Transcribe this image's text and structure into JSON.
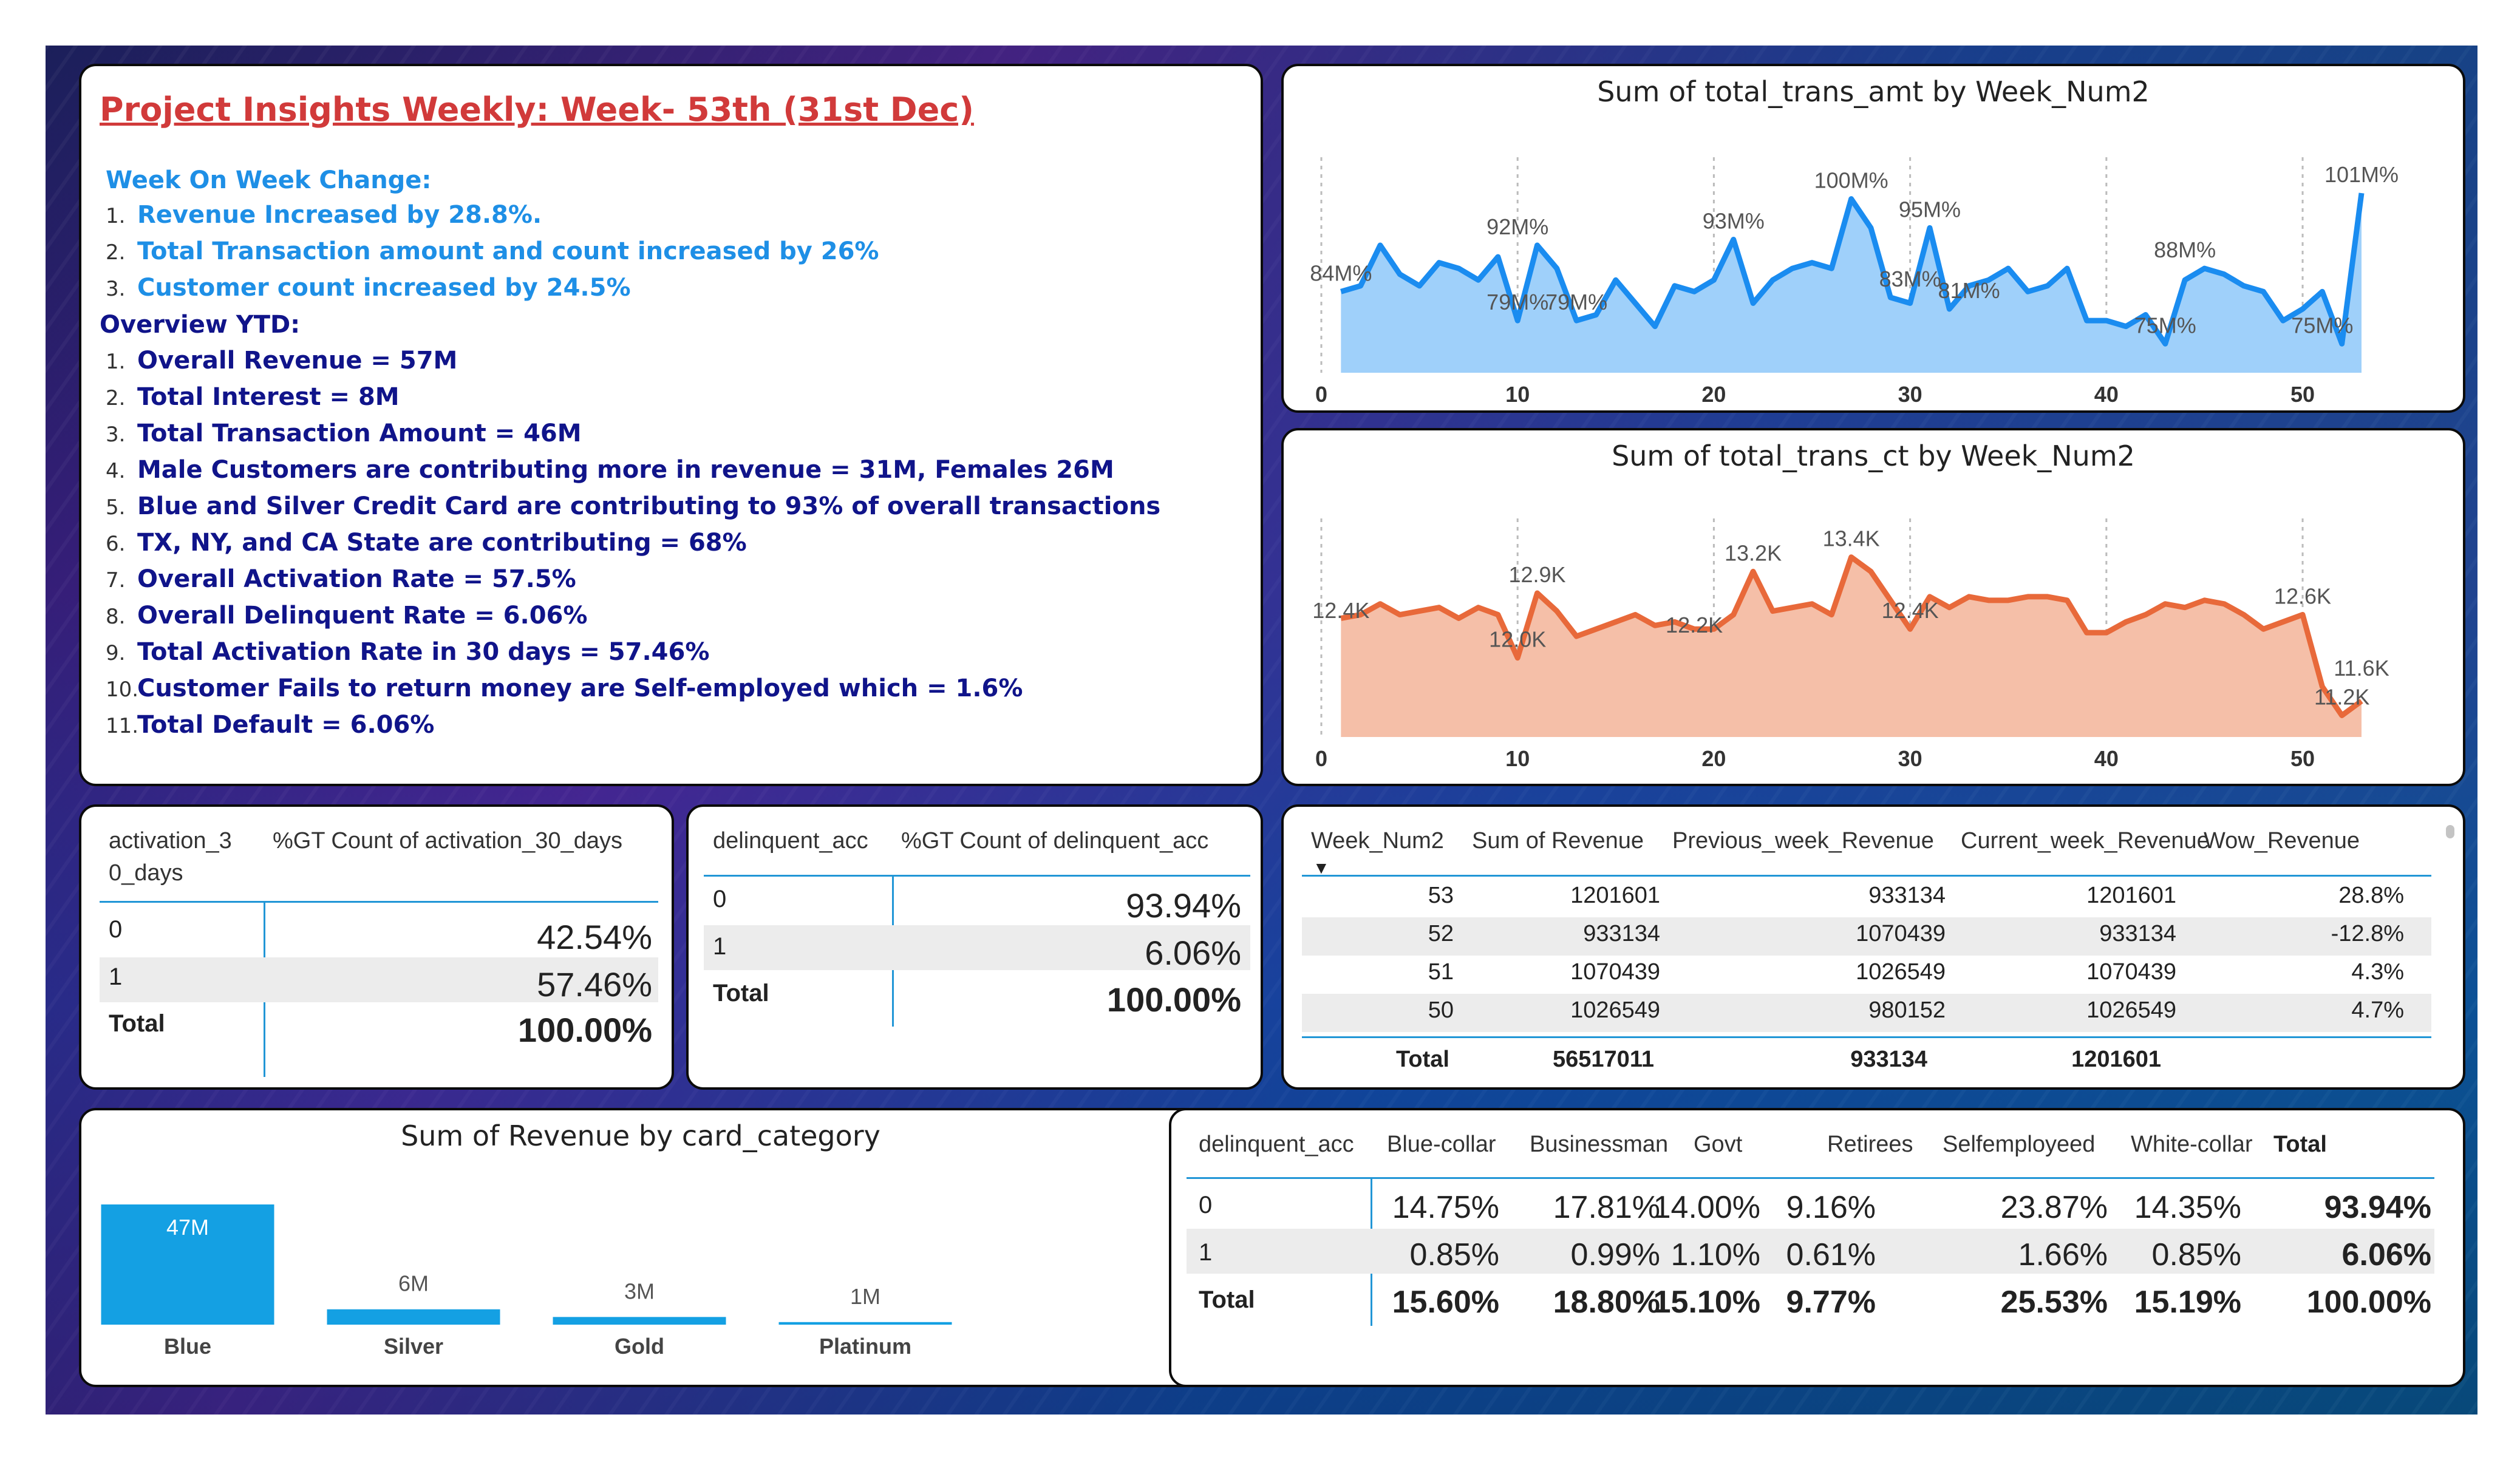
{
  "insights": {
    "title": "Project Insights Weekly: Week- 53th (31st Dec)",
    "wow_heading": "Week On Week Change:",
    "wow_items": [
      "Revenue Increased by 28.8%.",
      "Total Transaction amount and count increased by 26%",
      "Customer count increased by 24.5%"
    ],
    "ytd_heading": "Overview YTD:",
    "ytd_items": [
      "Overall Revenue = 57M",
      "Total Interest = 8M",
      "Total Transaction Amount = 46M",
      "Male Customers are contributing more in revenue = 31M, Females 26M",
      "Blue and Silver Credit Card  are contributing to 93% of overall transactions",
      "TX, NY, and CA State are contributing = 68%",
      "Overall Activation Rate = 57.5%",
      "Overall Delinquent Rate = 6.06%",
      "Total Activation Rate in 30 days = 57.46%",
      "Customer Fails to return money are Self-employed which = 1.6%",
      "Total Default = 6.06%"
    ],
    "colors": {
      "title": "#d13a3a",
      "wow": "#1e8fe6",
      "ytd": "#10148a"
    }
  },
  "chart_data": [
    {
      "type": "area",
      "title": "Sum of total_trans_amt by Week_Num2",
      "xlabel": "",
      "ylabel": "",
      "x_ticks": [
        0,
        10,
        20,
        30,
        40,
        50
      ],
      "xlim": [
        0,
        53
      ],
      "color": "#1a8cf0",
      "fill": "#9fd0fa",
      "x": [
        1,
        2,
        3,
        4,
        5,
        6,
        7,
        8,
        9,
        10,
        11,
        12,
        13,
        14,
        15,
        16,
        17,
        18,
        19,
        20,
        21,
        22,
        23,
        24,
        25,
        26,
        27,
        28,
        29,
        30,
        31,
        32,
        33,
        34,
        35,
        36,
        37,
        38,
        39,
        40,
        41,
        42,
        43,
        44,
        45,
        46,
        47,
        48,
        49,
        50,
        51,
        52,
        53
      ],
      "values": [
        84,
        85,
        92,
        87,
        85,
        89,
        88,
        86,
        90,
        79,
        92,
        88,
        79,
        80,
        86,
        82,
        78,
        85,
        84,
        86,
        93,
        82,
        86,
        88,
        89,
        88,
        100,
        95,
        83,
        82,
        95,
        81,
        85,
        86,
        88,
        84,
        85,
        88,
        79,
        79,
        78,
        80,
        75,
        86,
        88,
        87,
        85,
        84,
        79,
        81,
        84,
        75,
        101
      ],
      "labels": [
        {
          "x": 1,
          "y": 84,
          "text": "84M%"
        },
        {
          "x": 10,
          "y": 92,
          "text": "92M%"
        },
        {
          "x": 10,
          "y": 79,
          "text": "79M%"
        },
        {
          "x": 13,
          "y": 79,
          "text": "79M%"
        },
        {
          "x": 21,
          "y": 93,
          "text": "93M%"
        },
        {
          "x": 27,
          "y": 100,
          "text": "100M%"
        },
        {
          "x": 31,
          "y": 95,
          "text": "95M%"
        },
        {
          "x": 30,
          "y": 83,
          "text": "83M%"
        },
        {
          "x": 33,
          "y": 81,
          "text": "81M%"
        },
        {
          "x": 44,
          "y": 88,
          "text": "88M%"
        },
        {
          "x": 43,
          "y": 75,
          "text": "75M%"
        },
        {
          "x": 51,
          "y": 75,
          "text": "75M%"
        },
        {
          "x": 53,
          "y": 101,
          "text": "101M%"
        }
      ]
    },
    {
      "type": "area",
      "title": "Sum of total_trans_ct by Week_Num2",
      "xlabel": "",
      "ylabel": "",
      "x_ticks": [
        0,
        10,
        20,
        30,
        40,
        50
      ],
      "xlim": [
        0,
        53
      ],
      "color": "#e8693a",
      "fill": "#f5bfa8",
      "x": [
        1,
        2,
        3,
        4,
        5,
        6,
        7,
        8,
        9,
        10,
        11,
        12,
        13,
        14,
        15,
        16,
        17,
        18,
        19,
        20,
        21,
        22,
        23,
        24,
        25,
        26,
        27,
        28,
        29,
        30,
        31,
        32,
        33,
        34,
        35,
        36,
        37,
        38,
        39,
        40,
        41,
        42,
        43,
        44,
        45,
        46,
        47,
        48,
        49,
        50,
        51,
        52,
        53
      ],
      "values": [
        12.55,
        12.6,
        12.75,
        12.6,
        12.65,
        12.7,
        12.55,
        12.7,
        12.6,
        12.0,
        12.9,
        12.65,
        12.3,
        12.4,
        12.5,
        12.6,
        12.45,
        12.5,
        12.4,
        12.4,
        12.6,
        13.2,
        12.65,
        12.7,
        12.75,
        12.6,
        13.4,
        13.2,
        12.8,
        12.4,
        12.85,
        12.7,
        12.85,
        12.8,
        12.8,
        12.85,
        12.85,
        12.8,
        12.35,
        12.35,
        12.5,
        12.6,
        12.75,
        12.7,
        12.8,
        12.75,
        12.6,
        12.4,
        12.5,
        12.6,
        11.6,
        11.2,
        11.4
      ],
      "labels": [
        {
          "x": 1,
          "y": 12.4,
          "text": "12.4K"
        },
        {
          "x": 11,
          "y": 12.9,
          "text": "12.9K"
        },
        {
          "x": 10,
          "y": 12.0,
          "text": "12.0K"
        },
        {
          "x": 19,
          "y": 12.2,
          "text": "12.2K"
        },
        {
          "x": 22,
          "y": 13.2,
          "text": "13.2K"
        },
        {
          "x": 27,
          "y": 13.4,
          "text": "13.4K"
        },
        {
          "x": 30,
          "y": 12.4,
          "text": "12.4K"
        },
        {
          "x": 50,
          "y": 12.6,
          "text": "12.6K"
        },
        {
          "x": 53,
          "y": 11.6,
          "text": "11.6K"
        },
        {
          "x": 52,
          "y": 11.2,
          "text": "11.2K"
        }
      ]
    },
    {
      "type": "bar",
      "title": "Sum of Revenue by card_category",
      "categories": [
        "Blue",
        "Silver",
        "Gold",
        "Platinum"
      ],
      "values": [
        47,
        6,
        3,
        1
      ],
      "data_labels": [
        "47M",
        "6M",
        "3M",
        "1M"
      ],
      "color": "#14a0e3",
      "ylim": [
        0,
        47
      ]
    }
  ],
  "activation_table": {
    "col1": "activation_3\n0_days",
    "col1_line1": "activation_3",
    "col1_line2": "0_days",
    "col2": "%GT Count of activation_30_days",
    "rows": [
      {
        "key": "0",
        "val": "42.54%"
      },
      {
        "key": "1",
        "val": "57.46%"
      }
    ],
    "total_label": "Total",
    "total_val": "100.00%"
  },
  "delinquent_table": {
    "col1": "delinquent_acc",
    "col2": "%GT Count of delinquent_acc",
    "rows": [
      {
        "key": "0",
        "val": "93.94%"
      },
      {
        "key": "1",
        "val": "6.06%"
      }
    ],
    "total_label": "Total",
    "total_val": "100.00%"
  },
  "revenue_table": {
    "headers": [
      "Week_Num2",
      "Sum of Revenue",
      "Previous_week_Revenue",
      "Current_week_Revenue",
      "Wow_Revenue"
    ],
    "rows": [
      [
        "53",
        "1201601",
        "933134",
        "1201601",
        "28.8%"
      ],
      [
        "52",
        "933134",
        "1070439",
        "933134",
        "-12.8%"
      ],
      [
        "51",
        "1070439",
        "1026549",
        "1070439",
        "4.3%"
      ],
      [
        "50",
        "1026549",
        "980152",
        "1026549",
        "4.7%"
      ]
    ],
    "total": [
      "Total",
      "56517011",
      "933134",
      "1201601",
      ""
    ]
  },
  "matrix_table": {
    "headers": [
      "delinquent_acc",
      "Blue-collar",
      "Businessman",
      "Govt",
      "Retirees",
      "Selfemployeed",
      "White-collar",
      "Total"
    ],
    "rows": [
      [
        "0",
        "14.75%",
        "17.81%",
        "14.00%",
        "9.16%",
        "23.87%",
        "14.35%",
        "93.94%"
      ],
      [
        "1",
        "0.85%",
        "0.99%",
        "1.10%",
        "0.61%",
        "1.66%",
        "0.85%",
        "6.06%"
      ]
    ],
    "total": [
      "Total",
      "15.60%",
      "18.80%",
      "15.10%",
      "9.77%",
      "25.53%",
      "15.19%",
      "100.00%"
    ]
  }
}
